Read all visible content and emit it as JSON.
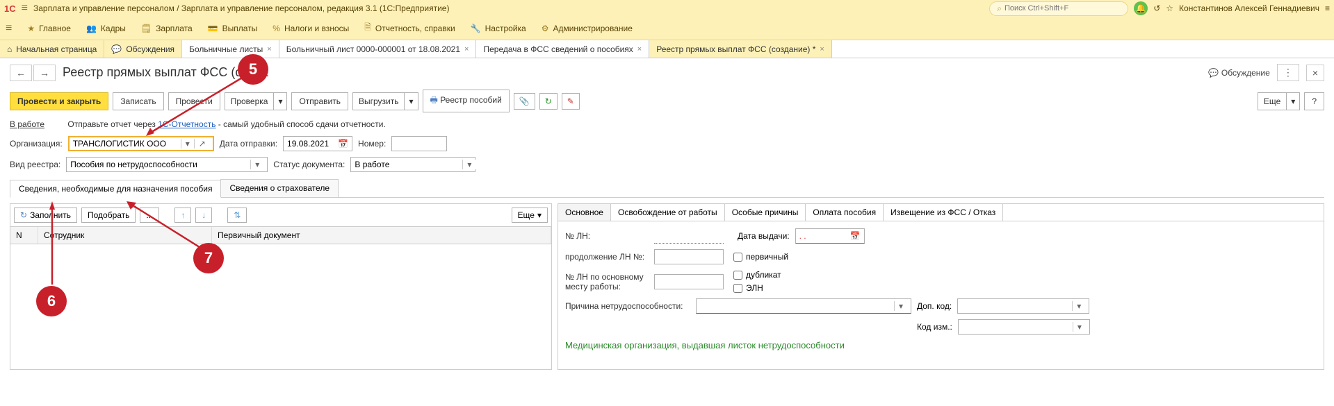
{
  "titlebar": {
    "logo": "1C",
    "title": "Зарплата и управление персоналом / Зарплата и управление персоналом, редакция 3.1  (1С:Предприятие)",
    "search_placeholder": "Поиск Ctrl+Shift+F",
    "username": "Константинов Алексей Геннадиевич"
  },
  "mainmenu": {
    "items": [
      {
        "label": "Главное"
      },
      {
        "label": "Кадры"
      },
      {
        "label": "Зарплата"
      },
      {
        "label": "Выплаты"
      },
      {
        "label": "Налоги и взносы"
      },
      {
        "label": "Отчетность, справки"
      },
      {
        "label": "Настройка"
      },
      {
        "label": "Администрирование"
      }
    ]
  },
  "nav_tabs": [
    {
      "label": "Начальная страница",
      "closable": false,
      "home": true
    },
    {
      "label": "Обсуждения",
      "closable": false
    },
    {
      "label": "Больничные листы",
      "closable": true
    },
    {
      "label": "Больничный лист 0000-000001 от 18.08.2021",
      "closable": true
    },
    {
      "label": "Передача в ФСС сведений о пособиях",
      "closable": true
    },
    {
      "label": "Реестр прямых выплат ФСС (создание) *",
      "closable": true,
      "current": true
    }
  ],
  "page": {
    "title": "Реестр прямых выплат ФСС (созда",
    "discussion": "Обсуждение"
  },
  "commands": {
    "save_close": "Провести и закрыть",
    "save": "Записать",
    "post": "Провести",
    "check": "Проверка",
    "send": "Отправить",
    "export": "Выгрузить",
    "registry": "Реестр пособий",
    "more": "Еще",
    "help": "?"
  },
  "status_row": {
    "status": "В работе",
    "text1": "Отправьте отчет через ",
    "link": "1С-Отчетность",
    "text2": " - самый удобный способ сдачи отчетности."
  },
  "form": {
    "org_label": "Организация:",
    "org_value": "ТРАНСЛОГИСТИК ООО",
    "send_date_label": "Дата отправки:",
    "send_date_value": "19.08.2021",
    "number_label": "Номер:",
    "number_value": "",
    "type_label": "Вид реестра:",
    "type_value": "Пособия по нетрудоспособности",
    "doc_status_label": "Статус документа:",
    "doc_status_value": "В работе"
  },
  "sub_tabs": {
    "tab1": "Сведения, необходимые для назначения пособия",
    "tab2": "Сведения о страхователе"
  },
  "left_panel": {
    "fill": "Заполнить",
    "pick": "Подобрать",
    "more": "Еще",
    "col_n": "N",
    "col_emp": "Сотрудник",
    "col_doc": "Первичный документ"
  },
  "detail_tabs": {
    "t1": "Основное",
    "t2": "Освобождение от работы",
    "t3": "Особые причины",
    "t4": "Оплата пособия",
    "t5": "Извещение из ФСС / Отказ"
  },
  "details": {
    "ln_num_label": "№ ЛН:",
    "issue_date_label": "Дата выдачи:",
    "issue_date_value": "  .  .    ",
    "cont_label": "продолжение ЛН №:",
    "ln_main_label": "№ ЛН по основному месту работы:",
    "chk_primary": "первичный",
    "chk_duplicate": "дубликат",
    "chk_eln": "ЭЛН",
    "reason_label": "Причина нетрудоспособности:",
    "addcode_label": "Доп. код:",
    "changecode_label": "Код изм.:",
    "med_org_title": "Медицинская организация, выдавшая листок нетрудоспособности"
  },
  "callouts": {
    "c5": "5",
    "c6": "6",
    "c7": "7"
  }
}
